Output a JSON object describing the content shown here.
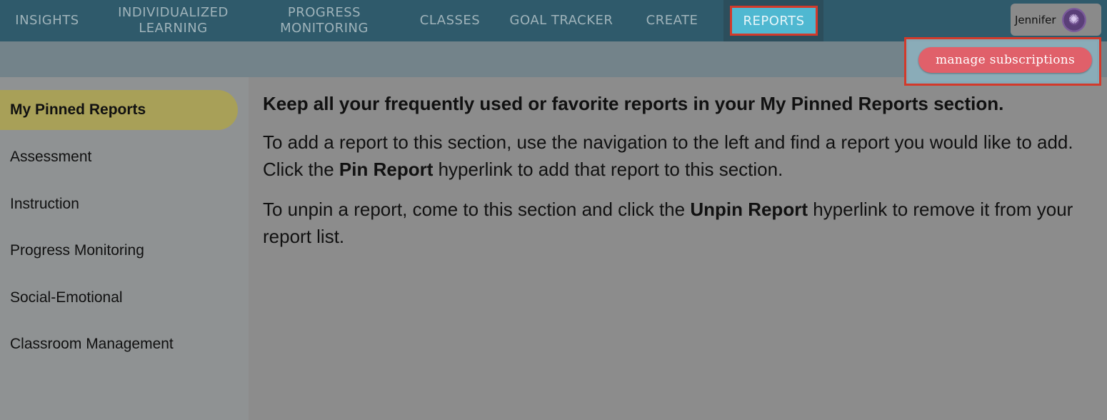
{
  "nav": {
    "items": [
      {
        "label": "INSIGHTS"
      },
      {
        "label": "INDIVIDUALIZED\nLEARNING"
      },
      {
        "label": "PROGRESS\nMONITORING"
      },
      {
        "label": "CLASSES"
      },
      {
        "label": "GOAL TRACKER"
      },
      {
        "label": "CREATE"
      },
      {
        "label": "REPORTS"
      }
    ],
    "user_name": "Jennifer"
  },
  "subbar": {
    "manage_label": "manage subscriptions"
  },
  "sidebar": {
    "items": [
      {
        "label": "My Pinned Reports"
      },
      {
        "label": "Assessment"
      },
      {
        "label": "Instruction"
      },
      {
        "label": "Progress Monitoring"
      },
      {
        "label": "Social-Emotional"
      },
      {
        "label": "Classroom Management"
      }
    ]
  },
  "content": {
    "heading": "Keep all your frequently used or favorite reports in your My Pinned Reports section.",
    "p1_a": "To add a report to this section, use the navigation to the left and find a report you would like to add. Click the ",
    "p1_b": "Pin Report",
    "p1_c": " hyperlink to add that report to this section.",
    "p2_a": "To unpin a report, come to this section and click the ",
    "p2_b": "Unpin Report",
    "p2_c": " hyperlink to remove it from your report list."
  },
  "colors": {
    "nav_bg": "#2f5a6b",
    "active_tab": "#4fb8d1",
    "highlight_border": "#d23a2b",
    "manage_button": "#e0606a",
    "sidebar_active": "#a8a058"
  }
}
